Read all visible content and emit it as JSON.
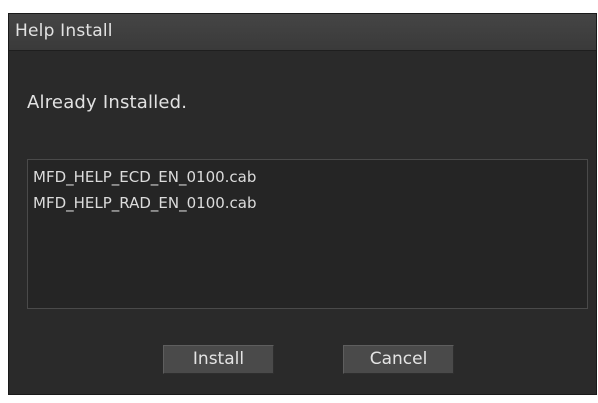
{
  "dialog": {
    "title": "Help Install",
    "message": "Already Installed.",
    "files": [
      "MFD_HELP_ECD_EN_0100.cab",
      "MFD_HELP_RAD_EN_0100.cab"
    ],
    "buttons": {
      "install_label": "Install",
      "cancel_label": "Cancel"
    }
  },
  "colors": {
    "background": "#2a2a2a",
    "titlebar": "#3f3f3f",
    "text": "#e2e2e2",
    "button": "#4a4a4a"
  }
}
